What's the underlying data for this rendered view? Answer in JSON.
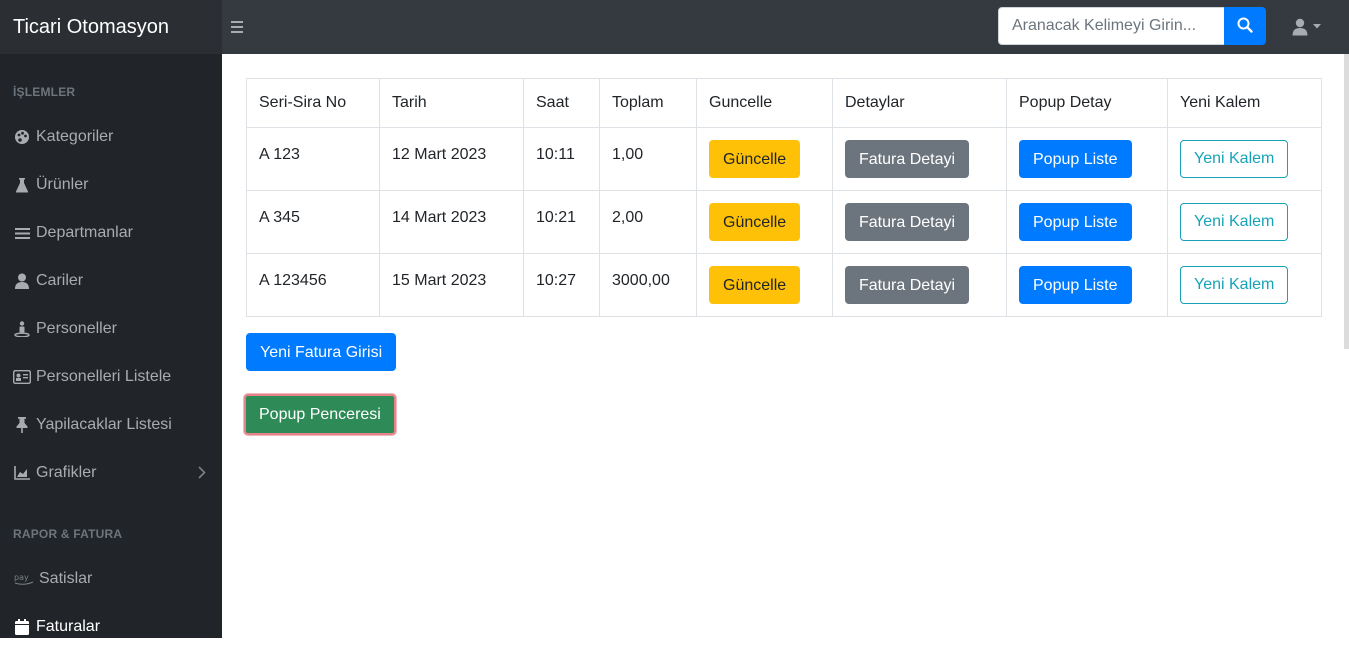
{
  "app": {
    "title": "Ticari Otomasyon"
  },
  "search": {
    "placeholder": "Aranacak Kelimeyi Girin..."
  },
  "sidebar": {
    "sections": [
      {
        "heading": "İŞLEMLER",
        "items": [
          {
            "label": "Kategoriler",
            "icon": "palette-icon"
          },
          {
            "label": "Ürünler",
            "icon": "flask-icon"
          },
          {
            "label": "Departmanlar",
            "icon": "list-icon"
          },
          {
            "label": "Cariler",
            "icon": "user-icon"
          },
          {
            "label": "Personeller",
            "icon": "street-view-icon"
          },
          {
            "label": "Personelleri Listele",
            "icon": "id-card-icon"
          },
          {
            "label": "Yapilacaklar Listesi",
            "icon": "thumbtack-icon"
          },
          {
            "label": "Grafikler",
            "icon": "chart-area-icon"
          }
        ]
      },
      {
        "heading": "RAPOR & FATURA",
        "items": [
          {
            "label": "Satislar",
            "icon": "pay-icon"
          },
          {
            "label": "Faturalar",
            "icon": "calendar-icon"
          }
        ]
      }
    ]
  },
  "table": {
    "headers": [
      "Seri-Sira No",
      "Tarih",
      "Saat",
      "Toplam",
      "Guncelle",
      "Detaylar",
      "Popup Detay",
      "Yeni Kalem"
    ],
    "rows": [
      {
        "seri": "A 123",
        "tarih": "12 Mart 2023",
        "saat": "10:11",
        "toplam": "1,00"
      },
      {
        "seri": "A 345",
        "tarih": "14 Mart 2023",
        "saat": "10:21",
        "toplam": "2,00"
      },
      {
        "seri": "A 123456",
        "tarih": "15 Mart 2023",
        "saat": "10:27",
        "toplam": "3000,00"
      }
    ],
    "buttons": {
      "update": "Güncelle",
      "detail": "Fatura Detayi",
      "popup": "Popup Liste",
      "new_item": "Yeni Kalem"
    }
  },
  "actions": {
    "new_invoice": "Yeni Fatura Girisi",
    "popup_window": "Popup Penceresi"
  }
}
